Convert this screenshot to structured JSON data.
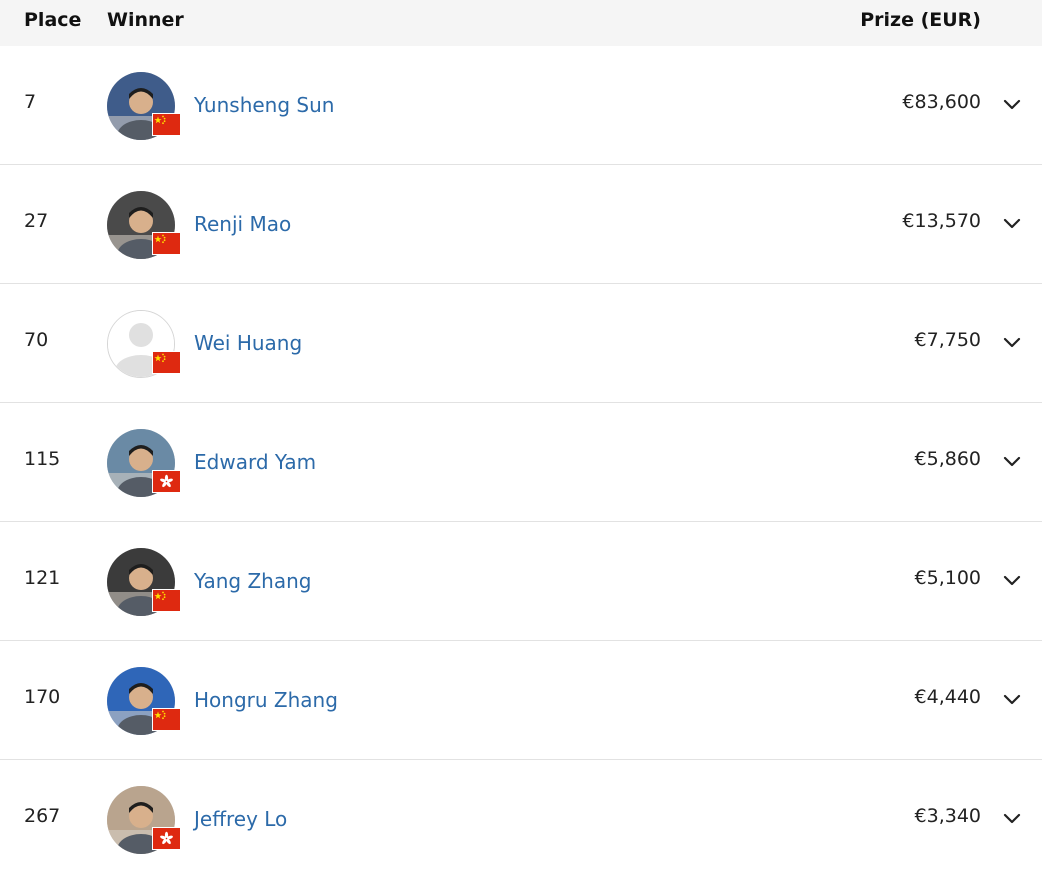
{
  "header": {
    "place": "Place",
    "winner": "Winner",
    "prize": "Prize (EUR)"
  },
  "rows": [
    {
      "place": "7",
      "name": "Yunsheng Sun",
      "prize": "€83,600",
      "flag": "china",
      "avatar": "photo",
      "avatar_bg": "#3f5c8a"
    },
    {
      "place": "27",
      "name": "Renji Mao",
      "prize": "€13,570",
      "flag": "china",
      "avatar": "photo",
      "avatar_bg": "#4a4a4a"
    },
    {
      "place": "70",
      "name": "Wei Huang",
      "prize": "€7,750",
      "flag": "china",
      "avatar": "placeholder",
      "avatar_bg": "#ffffff"
    },
    {
      "place": "115",
      "name": "Edward Yam",
      "prize": "€5,860",
      "flag": "hong-kong",
      "avatar": "photo",
      "avatar_bg": "#6a8aa5"
    },
    {
      "place": "121",
      "name": "Yang Zhang",
      "prize": "€5,100",
      "flag": "china",
      "avatar": "photo",
      "avatar_bg": "#3b3b3b"
    },
    {
      "place": "170",
      "name": "Hongru Zhang",
      "prize": "€4,440",
      "flag": "china",
      "avatar": "photo",
      "avatar_bg": "#2f66b8"
    },
    {
      "place": "267",
      "name": "Jeffrey Lo",
      "prize": "€3,340",
      "flag": "hong-kong",
      "avatar": "photo",
      "avatar_bg": "#b9a48e"
    }
  ],
  "colors": {
    "link": "#2c6aa9",
    "header_bg": "#f5f5f5",
    "divider": "#e2e2e2",
    "flag_red": "#de2910",
    "flag_yellow": "#ffde00"
  },
  "icons": {
    "expand": "chevron-down-icon",
    "placeholder_avatar": "user-silhouette-icon"
  }
}
